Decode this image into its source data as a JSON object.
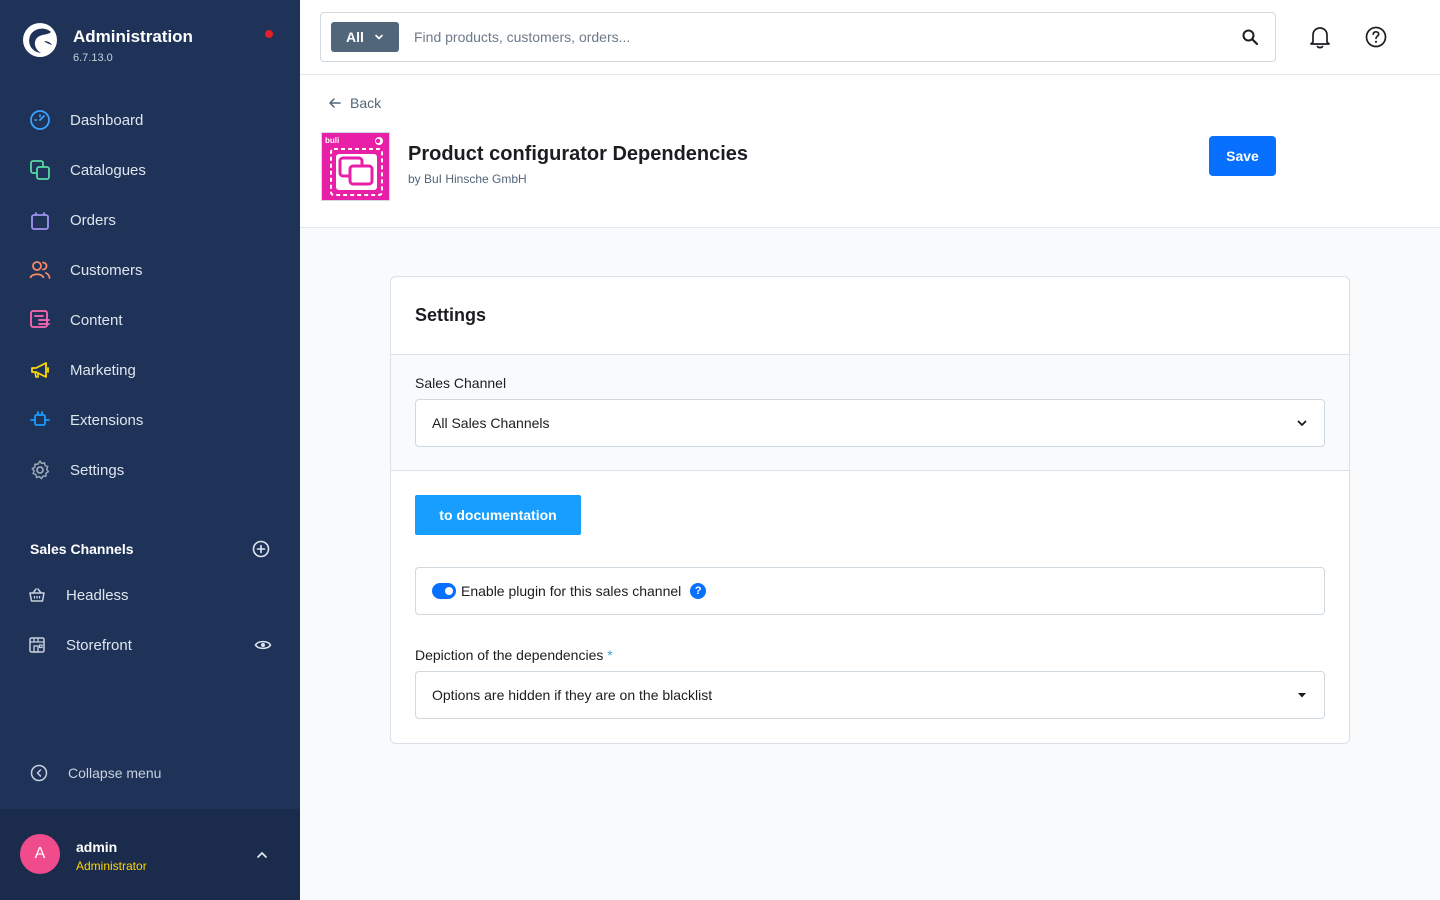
{
  "app": {
    "title": "Administration",
    "version": "6.7.13.0"
  },
  "nav": {
    "items": [
      {
        "label": "Dashboard",
        "icon": "dashboard-icon",
        "color": "#3ba3ff"
      },
      {
        "label": "Catalogues",
        "icon": "catalogue-icon",
        "color": "#57d9a3"
      },
      {
        "label": "Orders",
        "icon": "orders-bag-icon",
        "color": "#a092f0"
      },
      {
        "label": "Customers",
        "icon": "customers-icon",
        "color": "#f88962"
      },
      {
        "label": "Content",
        "icon": "content-icon",
        "color": "#ff68b4"
      },
      {
        "label": "Marketing",
        "icon": "marketing-megaphone-icon",
        "color": "#ffd700"
      },
      {
        "label": "Extensions",
        "icon": "extensions-plug-icon",
        "color": "#189eff"
      },
      {
        "label": "Settings",
        "icon": "settings-gear-icon",
        "color": "#9aa8b5"
      }
    ]
  },
  "sales_channels": {
    "heading": "Sales Channels",
    "items": [
      {
        "label": "Headless",
        "icon": "basket-icon"
      },
      {
        "label": "Storefront",
        "icon": "storefront-icon"
      }
    ]
  },
  "collapse_label": "Collapse menu",
  "user": {
    "initial": "A",
    "name": "admin",
    "role": "Administrator"
  },
  "search": {
    "type_label": "All",
    "placeholder": "Find products, customers, orders..."
  },
  "page": {
    "back_label": "Back",
    "title": "Product configurator Dependencies",
    "by": "by BuI Hinsche GmbH",
    "logo_text": "buli",
    "save_label": "Save"
  },
  "card": {
    "title": "Settings",
    "sales_channel_label": "Sales Channel",
    "sales_channel_value": "All Sales Channels",
    "doc_button": "to documentation",
    "enable_label": "Enable plugin for this sales channel",
    "enable_value": true,
    "help_mark": "?",
    "depiction_label": "Depiction of the dependencies",
    "required_mark": "*",
    "depiction_value": "Options are hidden if they are on the blacklist"
  },
  "colors": {
    "sidebar_bg": "#1f3358",
    "primary": "#0870ff",
    "doc_button": "#189eff",
    "avatar": "#f04b8b",
    "role_text": "#ffd700",
    "plugin_logo": "#e81fa7"
  }
}
